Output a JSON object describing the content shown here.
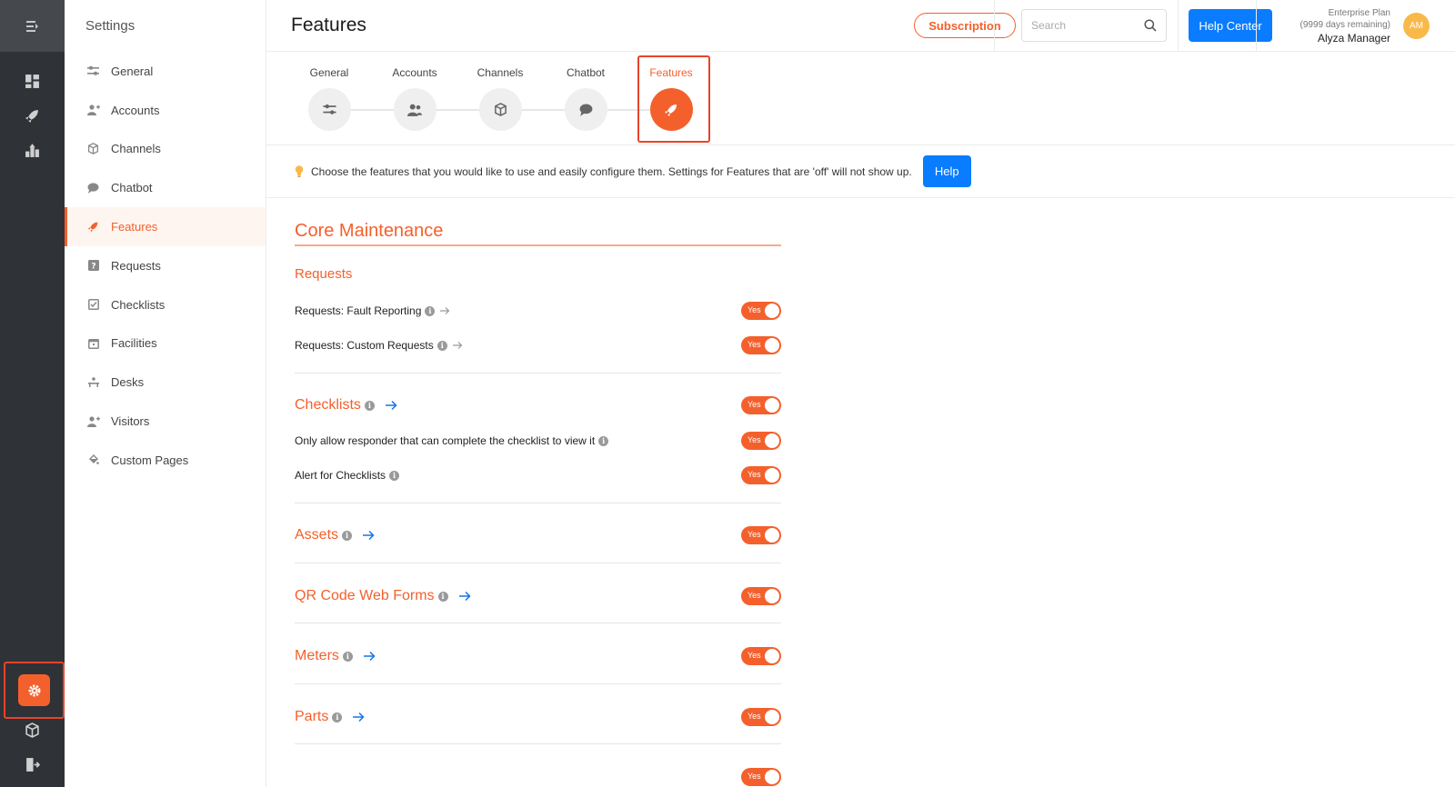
{
  "sidebar": {
    "title": "Settings",
    "items": [
      {
        "label": "General",
        "icon": "sliders-icon"
      },
      {
        "label": "Accounts",
        "icon": "users-icon"
      },
      {
        "label": "Channels",
        "icon": "cube-icon"
      },
      {
        "label": "Chatbot",
        "icon": "chat-bubble-icon"
      },
      {
        "label": "Features",
        "icon": "rocket-icon"
      },
      {
        "label": "Requests",
        "icon": "question-box-icon"
      },
      {
        "label": "Checklists",
        "icon": "checklist-icon"
      },
      {
        "label": "Facilities",
        "icon": "calendar-icon"
      },
      {
        "label": "Desks",
        "icon": "desk-icon"
      },
      {
        "label": "Visitors",
        "icon": "visitor-icon"
      },
      {
        "label": "Custom Pages",
        "icon": "paint-bucket-icon"
      }
    ],
    "active_index": 4
  },
  "header": {
    "title": "Features",
    "subscription_label": "Subscription",
    "search_placeholder": "Search",
    "help_center_label": "Help Center",
    "plan_name": "Enterprise Plan",
    "plan_remaining": "(9999 days remaining)",
    "user_name": "Alyza Manager",
    "avatar_initials": "AM"
  },
  "steps": [
    {
      "label": "General"
    },
    {
      "label": "Accounts"
    },
    {
      "label": "Channels"
    },
    {
      "label": "Chatbot"
    },
    {
      "label": "Features"
    }
  ],
  "info": {
    "text": "Choose the features that you would like to use and easily configure them. Settings for Features that are 'off' will not show up.",
    "help_label": "Help"
  },
  "content": {
    "section_title": "Core Maintenance",
    "requests_title": "Requests",
    "fault_reporting": "Requests: Fault Reporting",
    "custom_requests": "Requests: Custom Requests",
    "checklists_title": "Checklists",
    "only_allow_responder": "Only allow responder that can complete the checklist to view it",
    "alert_for_checklists": "Alert for Checklists",
    "assets_title": "Assets",
    "qr_title": "QR Code Web Forms",
    "meters_title": "Meters",
    "parts_title": "Parts",
    "toggle_label": "Yes"
  },
  "colors": {
    "accent": "#f4602c",
    "primary_button": "#0a7cff",
    "rail": "#2f3237"
  }
}
